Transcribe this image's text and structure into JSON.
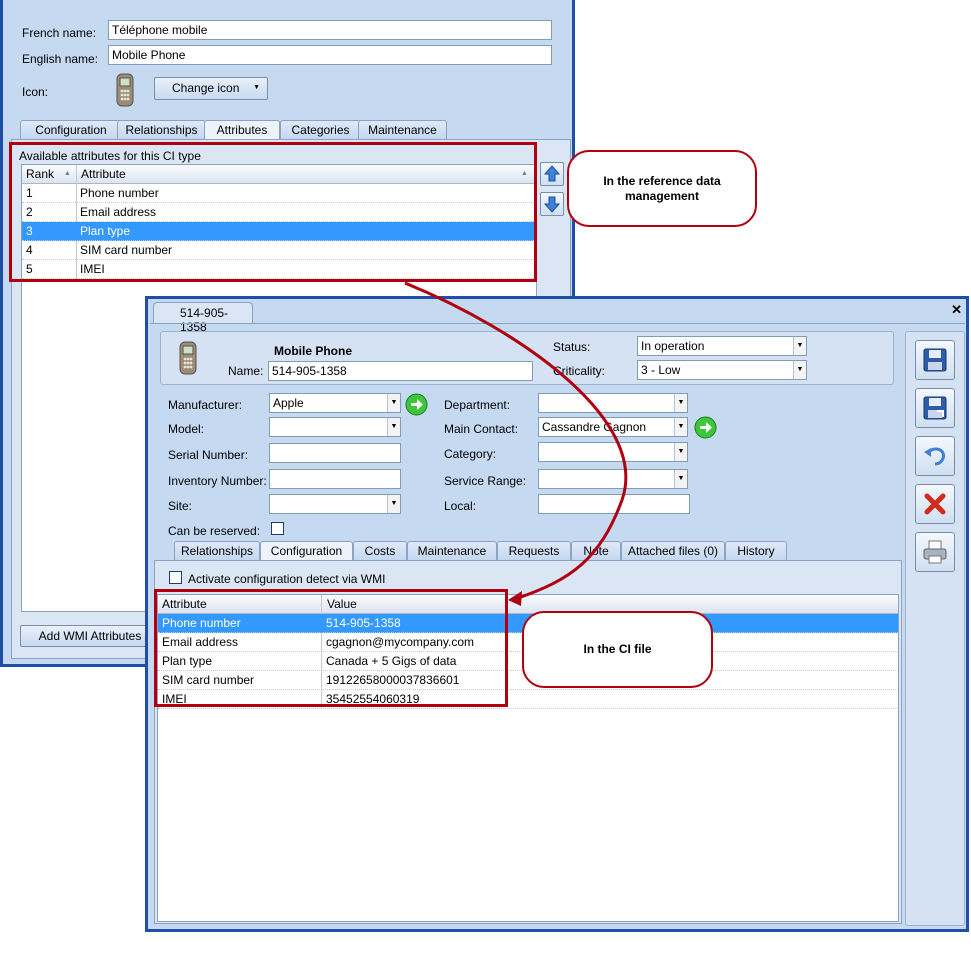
{
  "ref_window": {
    "french_name_label": "French name:",
    "french_name_value": "Téléphone mobile",
    "english_name_label": "English name:",
    "english_name_value": "Mobile Phone",
    "icon_label": "Icon:",
    "change_icon_label": "Change icon",
    "tabs": [
      "Configuration",
      "Relationships",
      "Attributes",
      "Categories",
      "Maintenance"
    ],
    "active_tab": "Attributes",
    "list_title": "Available attributes for this CI type",
    "columns": [
      "Rank",
      "Attribute"
    ],
    "rows": [
      {
        "rank": "1",
        "attribute": "Phone number"
      },
      {
        "rank": "2",
        "attribute": "Email address"
      },
      {
        "rank": "3",
        "attribute": "Plan type"
      },
      {
        "rank": "4",
        "attribute": "SIM card number"
      },
      {
        "rank": "5",
        "attribute": "IMEI"
      }
    ],
    "selected_row_rank": "3",
    "add_wmi_label": "Add WMI Attributes"
  },
  "callouts": {
    "reference": "In the reference data management",
    "ci_file": "In the CI file"
  },
  "ci_window": {
    "tab_title": "514-905-1358",
    "close_glyph": "✕",
    "ci_type": "Mobile Phone",
    "name_label": "Name:",
    "name_value": "514-905-1358",
    "status_label": "Status:",
    "status_value": "In operation",
    "criticality_label": "Criticality:",
    "criticality_value": "3 - Low",
    "manufacturer_label": "Manufacturer:",
    "manufacturer_value": "Apple",
    "model_label": "Model:",
    "model_value": "",
    "serial_label": "Serial Number:",
    "serial_value": "",
    "inventory_label": "Inventory Number:",
    "inventory_value": "",
    "site_label": "Site:",
    "site_value": "",
    "reservable_label": "Can be reserved:",
    "department_label": "Department:",
    "department_value": "",
    "main_contact_label": "Main Contact:",
    "main_contact_value": "Cassandre Gagnon",
    "category_label": "Category:",
    "category_value": "",
    "service_range_label": "Service Range:",
    "service_range_value": "",
    "local_label": "Local:",
    "local_value": "",
    "tabs": [
      "Relationships",
      "Configuration",
      "Costs",
      "Maintenance",
      "Requests",
      "Note",
      "Attached files (0)",
      "History"
    ],
    "active_tab": "Configuration",
    "wmi_checkbox_label": "Activate configuration detect via WMI",
    "columns": [
      "Attribute",
      "Value"
    ],
    "rows": [
      {
        "attribute": "Phone number",
        "value": "514-905-1358"
      },
      {
        "attribute": "Email address",
        "value": "cgagnon@mycompany.com"
      },
      {
        "attribute": "Plan type",
        "value": "Canada + 5 Gigs of data"
      },
      {
        "attribute": "SIM card number",
        "value": "19122658000037836601"
      },
      {
        "attribute": "IMEI",
        "value": "35452554060319"
      }
    ],
    "selected_row": "Phone number"
  },
  "colors": {
    "window_bg": "#c5d9f1",
    "window_border": "#1f4ea8",
    "selection": "#3399ff",
    "callout_red": "#b00010"
  },
  "icons": [
    "mobile-phone-icon",
    "arrow-up-icon",
    "arrow-down-icon",
    "go-arrow-icon",
    "save-icon",
    "save-close-icon",
    "undo-icon",
    "delete-icon",
    "print-icon"
  ]
}
